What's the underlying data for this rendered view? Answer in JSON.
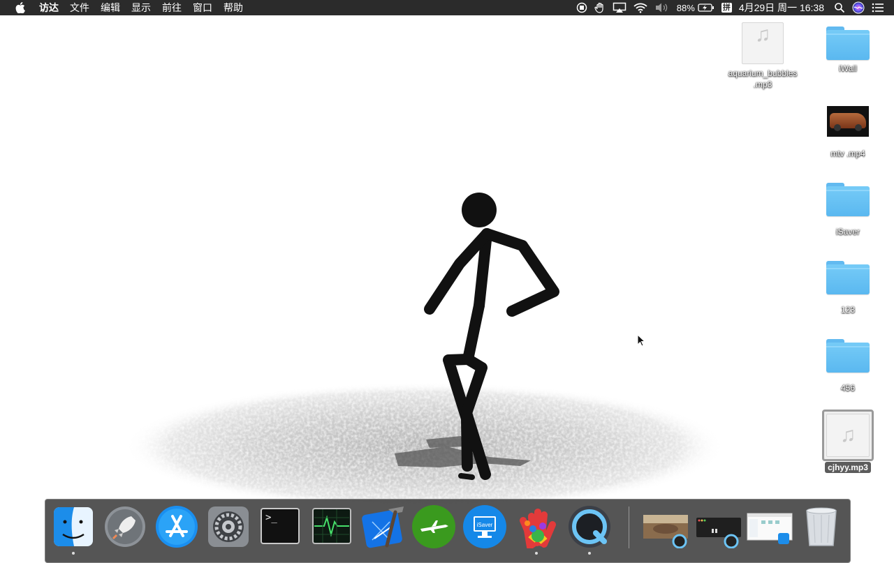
{
  "menubar": {
    "apple_icon": "apple-icon",
    "items": [
      "访达",
      "文件",
      "编辑",
      "显示",
      "前往",
      "窗口",
      "帮助"
    ],
    "battery_percent": "88%",
    "input_method": "拼",
    "datetime": "4月29日 周一 16:38"
  },
  "desktop": {
    "icons": [
      {
        "label": "aquarium_bubbles\n.mp3",
        "label_line1": "aquarium_bubbles",
        "label_line2": ".mp3",
        "kind": "audio"
      },
      {
        "label": "iWall",
        "kind": "folder"
      },
      {
        "label": "mtv .mp4",
        "kind": "video"
      },
      {
        "label": "iSaver",
        "kind": "folder"
      },
      {
        "label": "123",
        "kind": "folder"
      },
      {
        "label": "456",
        "kind": "folder"
      },
      {
        "label": "cjhyy.mp3",
        "kind": "audio",
        "selected": true
      }
    ]
  },
  "dock": {
    "apps": [
      "finder-icon",
      "launchpad-icon",
      "app-store-icon",
      "system-preferences-icon",
      "terminal-icon",
      "activity-monitor-icon",
      "xcode-icon",
      "flight-app-icon",
      "isaver-icon",
      "hand-paint-icon",
      "quicktime-icon"
    ],
    "isaver_label": "iSaver",
    "terminal_prompt": ">_",
    "running": [
      "finder-icon",
      "hand-paint-icon",
      "quicktime-icon"
    ],
    "recent_windows": [
      "quicktime-window-1",
      "quicktime-window-2",
      "finder-window"
    ],
    "trash": "trash-icon"
  },
  "colors": {
    "menubar": "#2b2b2b",
    "folder": "#5ab8f0",
    "dock": "#464646"
  }
}
